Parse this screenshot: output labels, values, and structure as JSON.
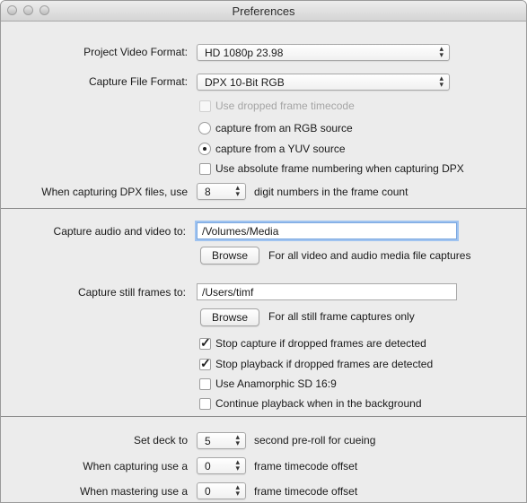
{
  "window": {
    "title": "Preferences"
  },
  "format": {
    "project_video_label": "Project Video Format:",
    "project_video_value": "HD 1080p 23.98",
    "capture_file_label": "Capture File Format:",
    "capture_file_value": "DPX 10-Bit RGB",
    "use_dropped_timecode": "Use dropped frame timecode",
    "rgb_source": "capture from an RGB source",
    "yuv_source": "capture from a YUV source",
    "absolute_numbering": "Use absolute frame numbering when capturing DPX",
    "dpx_digits_label": "When capturing DPX files, use",
    "dpx_digits_value": "8",
    "dpx_digits_suffix": "digit numbers in the frame count"
  },
  "capture": {
    "audio_video_label": "Capture audio and video to:",
    "audio_video_path": "/Volumes/Media",
    "browse1": "Browse",
    "browse1_desc": "For all video and audio media file captures",
    "still_label": "Capture still frames to:",
    "still_path": "/Users/timf",
    "browse2": "Browse",
    "browse2_desc": "For all still frame captures only",
    "stop_capture": "Stop capture if dropped frames are detected",
    "stop_playback": "Stop playback if dropped frames are detected",
    "anamorphic": "Use Anamorphic SD 16:9",
    "continue_playback": "Continue playback when in the background"
  },
  "deck": {
    "set_deck_label": "Set deck to",
    "preroll_value": "5",
    "preroll_suffix": "second pre-roll for cueing",
    "capturing_label": "When capturing use a",
    "capturing_value": "0",
    "capturing_suffix": "frame timecode offset",
    "mastering_label": "When mastering use a",
    "mastering_value": "0",
    "mastering_suffix": "frame timecode offset"
  }
}
